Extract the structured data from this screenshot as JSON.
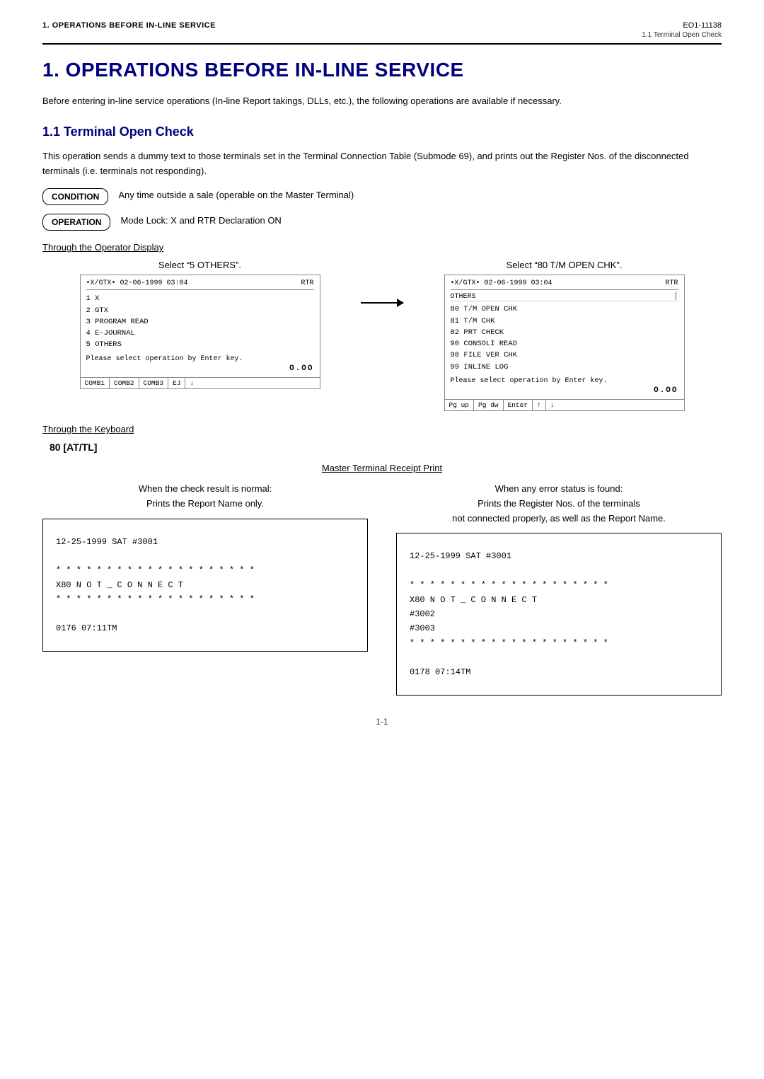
{
  "header": {
    "left": "1.   OPERATIONS BEFORE IN-LINE SERVICE",
    "doc_num": "EO1-11138",
    "section_ref": "1.1  Terminal Open Check"
  },
  "chapter": {
    "number": "1.",
    "title": "OPERATIONS BEFORE IN-LINE SERVICE"
  },
  "intro": "Before entering in-line service operations (In-line Report takings, DLLs, etc.), the following operations are available if necessary.",
  "section_1_1": {
    "title": "1.1   Terminal Open Check",
    "desc": "This operation sends a dummy text to those terminals set in the Terminal Connection Table (Submode 69), and prints out the Register Nos. of the disconnected terminals (i.e. terminals not responding).",
    "condition_badge": "CONDITION",
    "condition_text": "Any time outside a sale (operable on the Master Terminal)",
    "operation_badge": "OPERATION",
    "operation_text": "Mode Lock:  X and RTR Declaration ON"
  },
  "operator_display": {
    "heading": "Through the Operator Display",
    "left_label": "Select “5 OTHERS”.",
    "right_label": "Select “80 T/M OPEN CHK”.",
    "screen_left": {
      "header_left": "•X/GTX• 02-06-1999 03:04",
      "header_right": "RTR",
      "menu_lines": [
        "1   X",
        "2   GTX",
        "3   PROGRAM READ",
        "4   E-JOURNAL",
        "5   OTHERS"
      ],
      "footer_text": "Please select operation by Enter key.",
      "total": "O.OO",
      "buttons": [
        "COMB1",
        "COMB2",
        "COMB3",
        "EJ",
        "↓"
      ]
    },
    "screen_right": {
      "header_left": "•X/GTX• 02-06-1999 03:04",
      "header_right": "RTR",
      "submenu_title": "OTHERS",
      "menu_lines": [
        "80 T/M OPEN CHK",
        "81 T/M CHK",
        "82 PRT CHECK",
        "90 CONSOLI READ",
        "98 FILE VER CHK",
        "99 INLINE LOG"
      ],
      "footer_text": "Please select operation by Enter key.",
      "total": "O.OO",
      "buttons": [
        "Pg up",
        "Pg dw",
        "Enter",
        "↑",
        "↓"
      ]
    }
  },
  "keyboard": {
    "heading": "Through the Keyboard",
    "command": "80 [AT/TL]"
  },
  "master_receipt": {
    "heading": "Master Terminal Receipt Print",
    "left_desc_line1": "When the check result is normal:",
    "left_desc_line2": "Prints the Report Name only.",
    "right_desc_line1": "When any error status is found:",
    "right_desc_line2": "Prints the Register Nos. of the terminals",
    "right_desc_line3": "not connected properly, as well as the Report Name.",
    "receipt_left": [
      "12-25-1999  SAT   #3001",
      "",
      "* * * * * * * * * * * * * * * * * * * *",
      "X80   N O T _ C O N N E C T",
      "* * * * * * * * * * * * * * * * * * * *",
      "",
      "         0176  07:11TM"
    ],
    "receipt_right": [
      "12-25-1999  SAT   #3001",
      "",
      "* * * * * * * * * * * * * * * * * * * *",
      "X80   N O T _ C O N N E C T",
      "         #3002",
      "         #3003",
      "* * * * * * * * * * * * * * * * * * * *",
      "",
      "         0178  07:14TM"
    ]
  },
  "footer": {
    "page": "1-1"
  }
}
